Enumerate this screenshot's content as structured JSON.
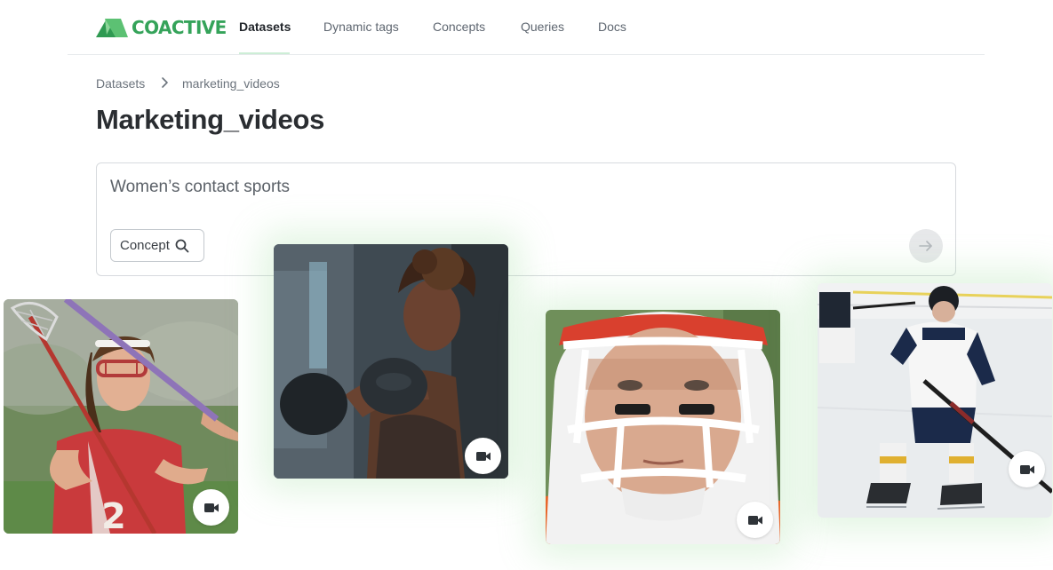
{
  "brand": {
    "name": "COACTIVE",
    "color": "#35a35a"
  },
  "nav": {
    "items": [
      {
        "label": "Datasets",
        "active": true
      },
      {
        "label": "Dynamic tags",
        "active": false
      },
      {
        "label": "Concepts",
        "active": false
      },
      {
        "label": "Queries",
        "active": false
      },
      {
        "label": "Docs",
        "active": false
      }
    ]
  },
  "breadcrumb": {
    "root": "Datasets",
    "separator_icon": "chevron-right-icon",
    "current": "marketing_videos"
  },
  "page": {
    "title": "Marketing_videos"
  },
  "search": {
    "query": "Women’s contact sports",
    "mode_label": "Concept",
    "mode_icon": "search-icon",
    "submit_icon": "arrow-right-icon"
  },
  "results": [
    {
      "subject": "lacrosse player",
      "media_icon": "video-camera-icon"
    },
    {
      "subject": "boxing athlete",
      "media_icon": "video-camera-icon"
    },
    {
      "subject": "football player in helmet",
      "media_icon": "video-camera-icon"
    },
    {
      "subject": "ice hockey player",
      "media_icon": "video-camera-icon"
    }
  ]
}
